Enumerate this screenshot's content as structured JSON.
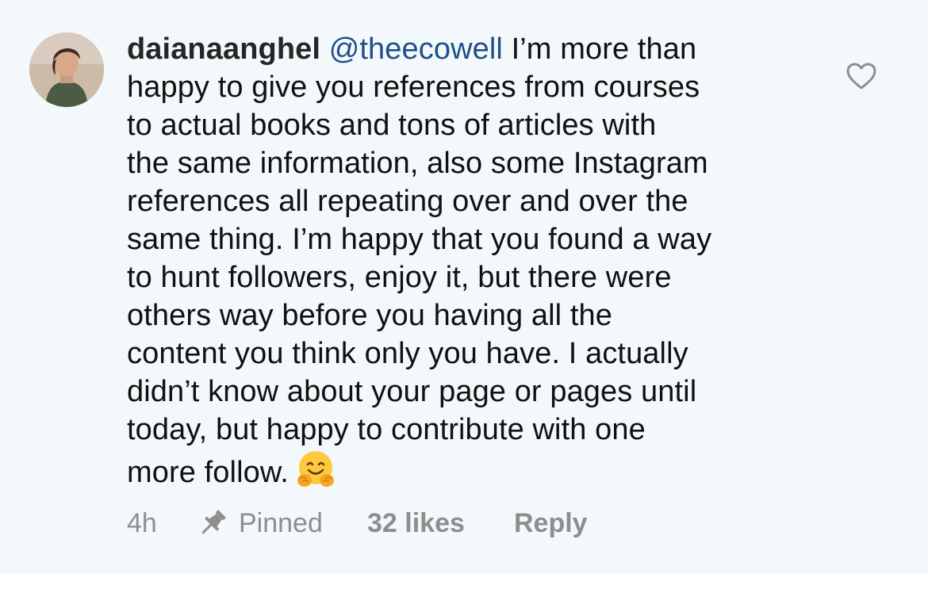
{
  "comment": {
    "username": "daianaanghel",
    "mention": "@theecowell",
    "lines": [
      " I’m more than",
      "happy to give you references from courses",
      "to actual books and tons of articles with",
      "the same information, also some Instagram",
      "references all repeating over and over the",
      "same thing. I’m happy that you found a way",
      "to hunt followers, enjoy it, but there were",
      "others way before you having all the",
      "content you think only you have. I actually",
      "didn’t know about your page or pages until",
      "today, but happy to contribute with one",
      "more follow."
    ],
    "emoji": "hugging-face-emoji"
  },
  "meta": {
    "time": "4h",
    "pinned_label": "Pinned",
    "likes_label": "32 likes",
    "reply_label": "Reply"
  },
  "icons": {
    "like": "heart-outline-icon",
    "pin": "pin-icon"
  },
  "colors": {
    "background": "#f3f8fb",
    "text": "#111111",
    "mention": "#1f4e8a",
    "meta": "#8e8e8e"
  }
}
